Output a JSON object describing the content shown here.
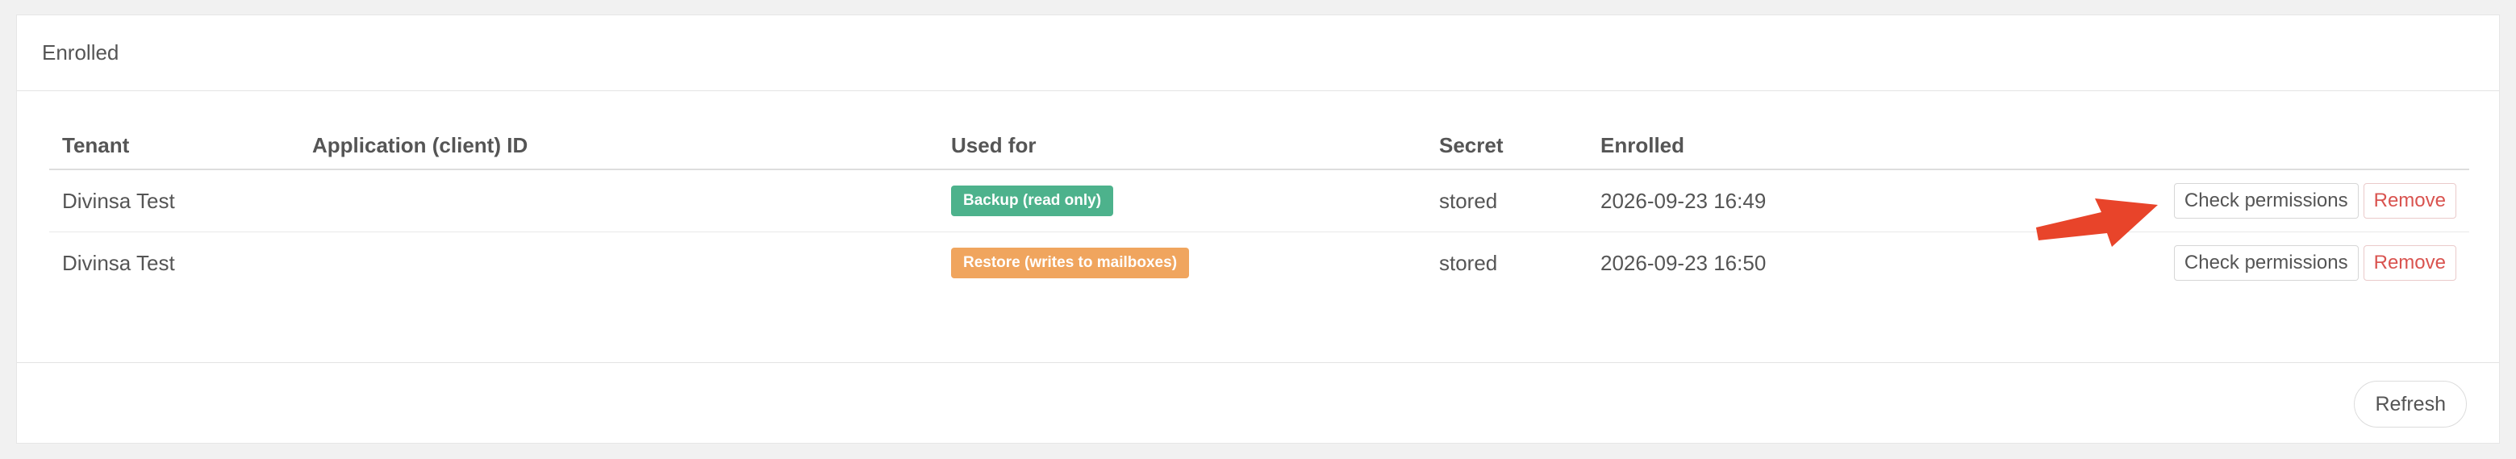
{
  "card": {
    "title": "Enrolled"
  },
  "table": {
    "headers": {
      "tenant": "Tenant",
      "app_id": "Application (client) ID",
      "used_for": "Used for",
      "secret": "Secret",
      "enrolled": "Enrolled"
    },
    "rows": [
      {
        "tenant": "Divinsa Test",
        "app_id": "",
        "used_for": "Backup (read only)",
        "used_for_color": "#4db28c",
        "secret": "stored",
        "enrolled": "2026-09-23 16:49",
        "check_label": "Check permissions",
        "remove_label": "Remove"
      },
      {
        "tenant": "Divinsa Test",
        "app_id": "",
        "used_for": "Restore (writes to mailboxes)",
        "used_for_color": "#f0a55e",
        "secret": "stored",
        "enrolled": "2026-09-23 16:50",
        "check_label": "Check permissions",
        "remove_label": "Remove"
      }
    ]
  },
  "footer": {
    "refresh_label": "Refresh"
  },
  "colors": {
    "remove_text": "#d9534f",
    "arrow": "#e8442a"
  },
  "annotation": {
    "icon": "arrow-right-icon"
  }
}
